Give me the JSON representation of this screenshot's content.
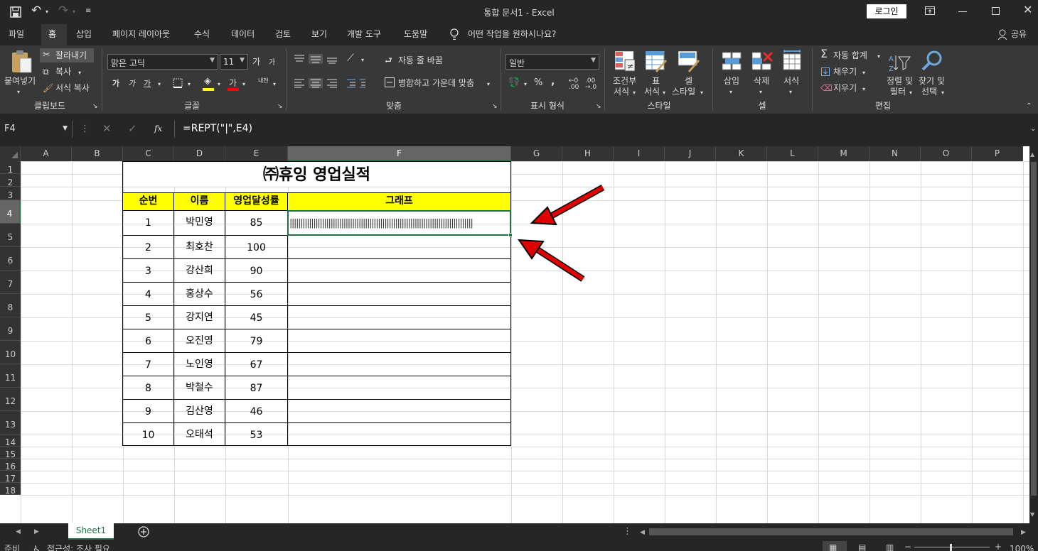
{
  "window": {
    "title": "통합 문서1  -  Excel",
    "login": "로그인"
  },
  "tabs": [
    "파일",
    "홈",
    "삽입",
    "페이지 레이아웃",
    "수식",
    "데이터",
    "검토",
    "보기",
    "개발 도구",
    "도움말"
  ],
  "tell_me": "어떤 작업을 원하시나요?",
  "share": "공유",
  "clipboard": {
    "paste": "붙여넣기",
    "cut": "잘라내기",
    "copy": "복사",
    "format_painter": "서식 복사",
    "group": "클립보드"
  },
  "font": {
    "name": "맑은 고딕",
    "size": "11",
    "group": "글꼴",
    "bold": "가",
    "italic": "가",
    "underline": "가",
    "grow": "가",
    "shrink": "가",
    "color_a": "가",
    "phonetic": "내천"
  },
  "alignment": {
    "wrap": "자동 줄 바꿈",
    "merge": "병합하고 가운데 맞춤",
    "group": "맞춤"
  },
  "number": {
    "format": "일반",
    "group": "표시 형식",
    "percent": "%"
  },
  "styles": {
    "conditional_1": "조건부",
    "conditional_2": "서식",
    "table_1": "표",
    "table_2": "서식",
    "cell_1": "셀",
    "cell_2": "스타일",
    "group": "스타일"
  },
  "cells": {
    "insert": "삽입",
    "delete": "삭제",
    "format": "서식",
    "group": "셀"
  },
  "editing": {
    "autosum": "자동 합계",
    "fill": "채우기",
    "clear": "지우기",
    "sort_1": "정렬 및",
    "sort_2": "필터",
    "find_1": "찾기 및",
    "find_2": "선택",
    "group": "편집"
  },
  "formula_bar": {
    "name_box": "F4",
    "fx": "fx",
    "formula": "=REPT(\"|\",E4)"
  },
  "columns": [
    "A",
    "B",
    "C",
    "D",
    "E",
    "F",
    "G",
    "H",
    "I",
    "J",
    "K",
    "L",
    "M",
    "N",
    "O",
    "P"
  ],
  "rows": [
    "1",
    "2",
    "3",
    "4",
    "5",
    "6",
    "7",
    "8",
    "9",
    "10",
    "11",
    "12",
    "13",
    "14",
    "15",
    "16",
    "17",
    "18"
  ],
  "table": {
    "title": "㈜휴잉 영업실적",
    "headers": [
      "순번",
      "이름",
      "영업달성률",
      "그래프"
    ],
    "rows": [
      {
        "no": "1",
        "name": "박민영",
        "rate": "85"
      },
      {
        "no": "2",
        "name": "최호찬",
        "rate": "100"
      },
      {
        "no": "3",
        "name": "강산희",
        "rate": "90"
      },
      {
        "no": "4",
        "name": "홍상수",
        "rate": "56"
      },
      {
        "no": "5",
        "name": "강지연",
        "rate": "45"
      },
      {
        "no": "6",
        "name": "오진영",
        "rate": "79"
      },
      {
        "no": "7",
        "name": "노인영",
        "rate": "67"
      },
      {
        "no": "8",
        "name": "박철수",
        "rate": "87"
      },
      {
        "no": "9",
        "name": "김산영",
        "rate": "46"
      },
      {
        "no": "10",
        "name": "오태석",
        "rate": "53"
      }
    ],
    "graph_f4": "|||||||||||||||||||||||||||||||||||||||||||||||||||||||||||||||||||||||||||||||||||||"
  },
  "sheet_tab": "Sheet1",
  "status": {
    "ready": "준비",
    "accessibility": "접근성: 조사 필요",
    "zoom": "100%"
  },
  "colors": {
    "header_fill": "#ffff00",
    "selection": "#217346",
    "arrow": "#e00000"
  }
}
